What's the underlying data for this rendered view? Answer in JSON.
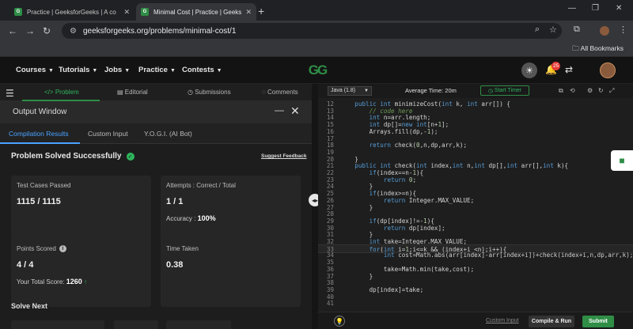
{
  "browser": {
    "tabs": [
      {
        "title": "Practice | GeeksforGeeks | A co"
      },
      {
        "title": "Minimal Cost | Practice | Geeks"
      }
    ],
    "url": "geeksforgeeks.org/problems/minimal-cost/1",
    "bookmarks_label": "All Bookmarks"
  },
  "site": {
    "menu": [
      "Courses",
      "Tutorials",
      "Jobs",
      "Practice",
      "Contests"
    ],
    "logo_text": "GG",
    "notification_count": "25"
  },
  "problem_nav": {
    "tabs": [
      "Problem",
      "Editorial",
      "Submissions",
      "Comments"
    ]
  },
  "output": {
    "title": "Output Window",
    "tabs": [
      "Compilation Results",
      "Custom Input",
      "Y.O.G.I. (AI Bot)"
    ],
    "status": "Problem Solved Successfully",
    "feedback": "Suggest Feedback",
    "cards": {
      "tests_label": "Test Cases Passed",
      "tests_value": "1115 / 1115",
      "attempts_label": "Attempts : Correct / Total",
      "attempts_value": "1 / 1",
      "accuracy_label": "Accuracy :",
      "accuracy_value": "100%",
      "points_label": "Points Scored",
      "points_value": "4 / 4",
      "total_label": "Your Total Score:",
      "total_value": "1260",
      "time_label": "Time Taken",
      "time_value": "0.38"
    },
    "solve_next": "Solve Next"
  },
  "editor": {
    "language": "Java (1.8)",
    "avg_time": "Average Time: 20m",
    "timer": "Start Timer",
    "custom_input": "Custom Input",
    "run": "Compile & Run",
    "submit": "Submit",
    "current_line": "33",
    "lines": [
      {
        "n": "12",
        "t": "    public int minimizeCost(int k, int arr[]) {"
      },
      {
        "n": "13",
        "t": "        // code here"
      },
      {
        "n": "14",
        "t": "        int n=arr.length;"
      },
      {
        "n": "15",
        "t": "        int dp[]=new int[n+1];"
      },
      {
        "n": "16",
        "t": "        Arrays.fill(dp,-1);"
      },
      {
        "n": "17",
        "t": ""
      },
      {
        "n": "18",
        "t": "        return check(0,n,dp,arr,k);"
      },
      {
        "n": "19",
        "t": ""
      },
      {
        "n": "20",
        "t": "    }"
      },
      {
        "n": "21",
        "t": "    public int check(int index,int n,int dp[],int arr[],int k){"
      },
      {
        "n": "22",
        "t": "        if(index==n-1){"
      },
      {
        "n": "23",
        "t": "            return 0;"
      },
      {
        "n": "24",
        "t": "        }"
      },
      {
        "n": "25",
        "t": "        if(index>=n){"
      },
      {
        "n": "26",
        "t": "            return Integer.MAX_VALUE;"
      },
      {
        "n": "27",
        "t": "        }"
      },
      {
        "n": "28",
        "t": ""
      },
      {
        "n": "29",
        "t": "        if(dp[index]!=-1){"
      },
      {
        "n": "30",
        "t": "            return dp[index];"
      },
      {
        "n": "31",
        "t": "        }"
      },
      {
        "n": "32",
        "t": "        int take=Integer.MAX_VALUE;"
      },
      {
        "n": "33",
        "t": "        for(int i=1;i<=k && (index+i <n);i++){"
      },
      {
        "n": "34",
        "t": "            int cost=Math.abs(arr[index]-arr[index+i])+check(index+i,n,dp,arr,k);"
      },
      {
        "n": "35",
        "t": ""
      },
      {
        "n": "36",
        "t": "            take=Math.min(take,cost);"
      },
      {
        "n": "37",
        "t": "        }"
      },
      {
        "n": "38",
        "t": ""
      },
      {
        "n": "39",
        "t": "        dp[index]=take;"
      },
      {
        "n": "40",
        "t": ""
      },
      {
        "n": "41",
        "t": ""
      }
    ]
  },
  "colors": {
    "accent_green": "#2f8d46",
    "link_blue": "#4aa3ff",
    "editor_bg": "#1e1e1e"
  }
}
